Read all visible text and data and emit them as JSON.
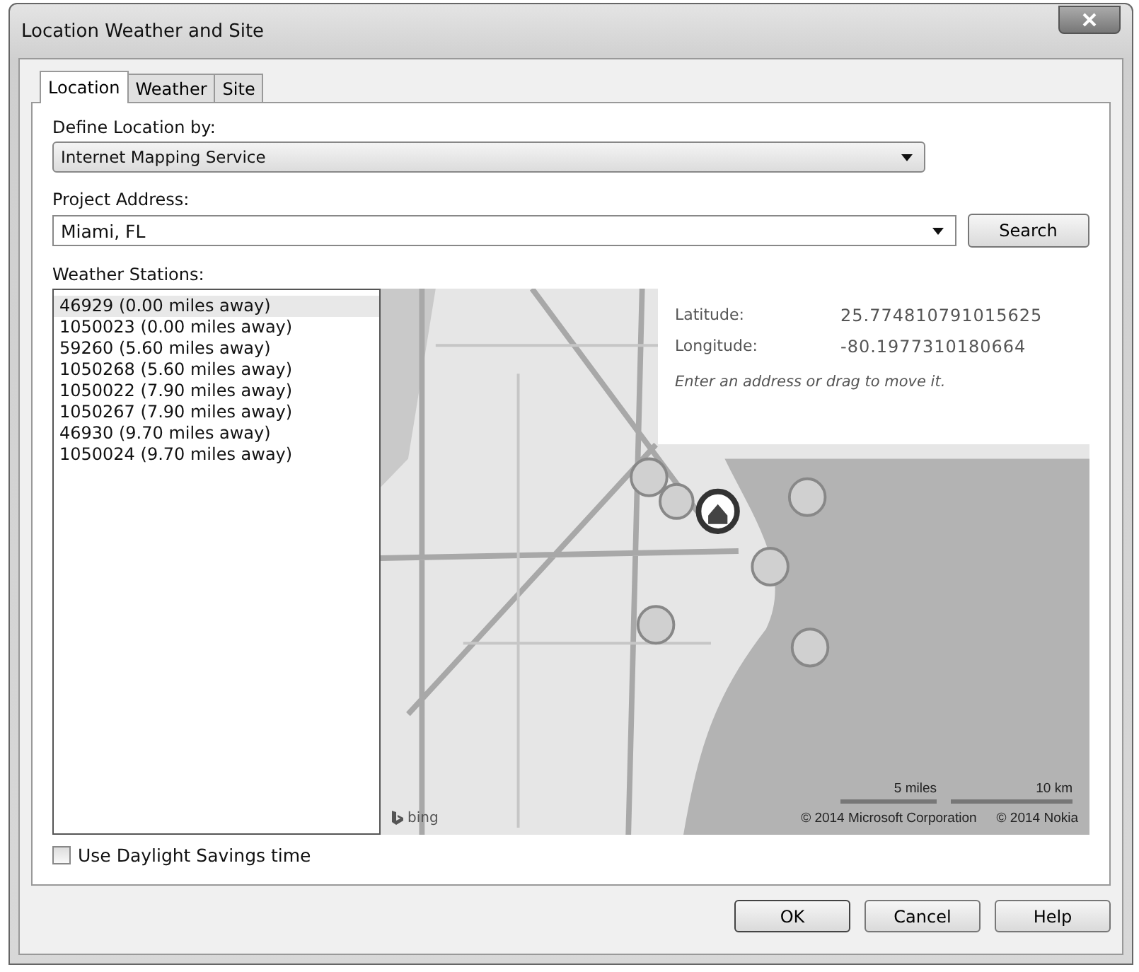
{
  "window": {
    "title": "Location Weather and Site"
  },
  "tabs": [
    {
      "label": "Location",
      "selected": true
    },
    {
      "label": "Weather",
      "selected": false
    },
    {
      "label": "Site",
      "selected": false
    }
  ],
  "define_location": {
    "label": "Define Location by:",
    "value": "Internet Mapping Service"
  },
  "project_address": {
    "label": "Project Address:",
    "value": "Miami, FL",
    "search_button": "Search"
  },
  "weather_stations": {
    "label": "Weather Stations:",
    "items": [
      {
        "text": "46929 (0.00 miles away)",
        "selected": true
      },
      {
        "text": "1050023 (0.00 miles away)",
        "selected": false
      },
      {
        "text": "59260 (5.60 miles away)",
        "selected": false
      },
      {
        "text": "1050268 (5.60 miles away)",
        "selected": false
      },
      {
        "text": "1050022 (7.90 miles away)",
        "selected": false
      },
      {
        "text": "1050267 (7.90 miles away)",
        "selected": false
      },
      {
        "text": "46930 (9.70 miles away)",
        "selected": false
      },
      {
        "text": "1050024 (9.70 miles away)",
        "selected": false
      }
    ]
  },
  "map": {
    "kind": "picture",
    "popup": {
      "rows": [
        {
          "label": "Latitude:",
          "value": "25.774810791015625"
        },
        {
          "label": "Longitude:",
          "value": "-80.1977310180664"
        }
      ],
      "hint": "Enter an address or drag to move it."
    },
    "logo": "bing",
    "scale": [
      "5 miles",
      "10 km"
    ],
    "copyright": [
      "© 2014 Microsoft Corporation",
      "© 2014 Nokia"
    ]
  },
  "daylight_savings": {
    "label": "Use Daylight Savings time",
    "checked": false
  },
  "buttons": [
    "OK",
    "Cancel",
    "Help"
  ]
}
